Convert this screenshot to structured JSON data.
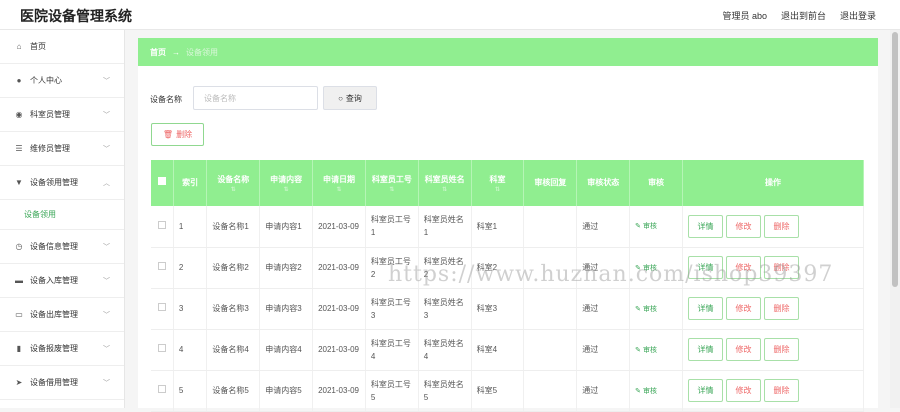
{
  "header": {
    "app_title": "医院设备管理系统",
    "admin_label": "管理员 abo",
    "back_label": "退出到前台",
    "logout_label": "退出登录"
  },
  "sidebar": {
    "items": [
      {
        "label": "首页",
        "icon": "home-icon",
        "glyph": "⌂"
      },
      {
        "label": "个人中心",
        "icon": "user-icon",
        "glyph": "●",
        "chevron": "﹀"
      },
      {
        "label": "科室员管理",
        "icon": "pin-icon",
        "glyph": "◉",
        "chevron": "﹀"
      },
      {
        "label": "维修员管理",
        "icon": "list-icon",
        "glyph": "☰",
        "chevron": "﹀"
      },
      {
        "label": "设备领用管理",
        "icon": "funnel-icon",
        "glyph": "▼",
        "chevron": "︿"
      },
      {
        "label": "设备信息管理",
        "icon": "clock-icon",
        "glyph": "◷",
        "chevron": "﹀"
      },
      {
        "label": "设备入库管理",
        "icon": "monitor-icon",
        "glyph": "▬",
        "chevron": "﹀"
      },
      {
        "label": "设备出库管理",
        "icon": "message-icon",
        "glyph": "▭",
        "chevron": "﹀"
      },
      {
        "label": "设备报废管理",
        "icon": "bar-chart-icon",
        "glyph": "▮",
        "chevron": "﹀"
      },
      {
        "label": "设备借用管理",
        "icon": "send-icon",
        "glyph": "➤",
        "chevron": "﹀"
      }
    ],
    "sub_item": "设备领用"
  },
  "breadcrumb": {
    "home": "首页",
    "arrow": "→",
    "current": "设备领用"
  },
  "search": {
    "label": "设备名称",
    "placeholder": "设备名称",
    "button": "查询"
  },
  "toolbar": {
    "delete_label": "删除"
  },
  "table": {
    "columns": [
      "索引",
      "设备名称",
      "申请内容",
      "申请日期",
      "科室员工号",
      "科室员姓名",
      "科室",
      "审核回复",
      "审核状态",
      "审核",
      "操作"
    ],
    "rows": [
      {
        "index": "1",
        "name": "设备名称1",
        "content": "申请内容1",
        "date": "2021-03-09",
        "staff_no": "科室员工号1",
        "staff_name": "科室员姓名1",
        "dept": "科室1",
        "reply": "",
        "status": "通过",
        "audit": "审核"
      },
      {
        "index": "2",
        "name": "设备名称2",
        "content": "申请内容2",
        "date": "2021-03-09",
        "staff_no": "科室员工号2",
        "staff_name": "科室员姓名2",
        "dept": "科室2",
        "reply": "",
        "status": "通过",
        "audit": "审核"
      },
      {
        "index": "3",
        "name": "设备名称3",
        "content": "申请内容3",
        "date": "2021-03-09",
        "staff_no": "科室员工号3",
        "staff_name": "科室员姓名3",
        "dept": "科室3",
        "reply": "",
        "status": "通过",
        "audit": "审核"
      },
      {
        "index": "4",
        "name": "设备名称4",
        "content": "申请内容4",
        "date": "2021-03-09",
        "staff_no": "科室员工号4",
        "staff_name": "科室员姓名4",
        "dept": "科室4",
        "reply": "",
        "status": "通过",
        "audit": "审核"
      },
      {
        "index": "5",
        "name": "设备名称5",
        "content": "申请内容5",
        "date": "2021-03-09",
        "staff_no": "科室员工号5",
        "staff_name": "科室员姓名5",
        "dept": "科室5",
        "reply": "",
        "status": "通过",
        "audit": "审核"
      }
    ],
    "actions": {
      "detail": "详情",
      "edit": "修改",
      "remove": "删除"
    }
  },
  "watermark": "https://www.huzhan.com/ishop39397",
  "colors": {
    "accent": "#90ee90",
    "text_green": "#3aa657",
    "danger": "#e66666"
  }
}
